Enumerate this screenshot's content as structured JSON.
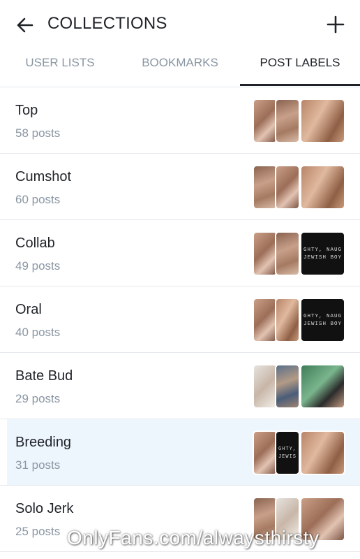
{
  "header": {
    "title": "COLLECTIONS",
    "back_icon": "arrow-left-icon",
    "add_icon": "plus-icon"
  },
  "tabs": [
    {
      "label": "USER LISTS",
      "active": false
    },
    {
      "label": "BOOKMARKS",
      "active": false
    },
    {
      "label": "POST LABELS",
      "active": true
    }
  ],
  "collections": [
    {
      "name": "Top",
      "count": "58 posts"
    },
    {
      "name": "Cumshot",
      "count": "60 posts"
    },
    {
      "name": "Collab",
      "count": "49 posts",
      "thumb_text": [
        "GHTY, NAUG",
        "JEWISH BOY"
      ]
    },
    {
      "name": "Oral",
      "count": "40 posts",
      "thumb_text": [
        "GHTY, NAUG",
        "JEWISH BOY"
      ]
    },
    {
      "name": "Bate Bud",
      "count": "29 posts"
    },
    {
      "name": "Breeding",
      "count": "31 posts",
      "selected": true,
      "thumb_text": [
        "GHTY,",
        "JEWIS"
      ]
    },
    {
      "name": "Solo Jerk",
      "count": "25 posts"
    }
  ],
  "watermark": "OnlyFans.com/alwaysthirsty",
  "colors": {
    "accent": "#1f2328",
    "muted": "#8a96a3",
    "selected_bg": "#eef6fd",
    "divider": "#e5e8ec"
  }
}
